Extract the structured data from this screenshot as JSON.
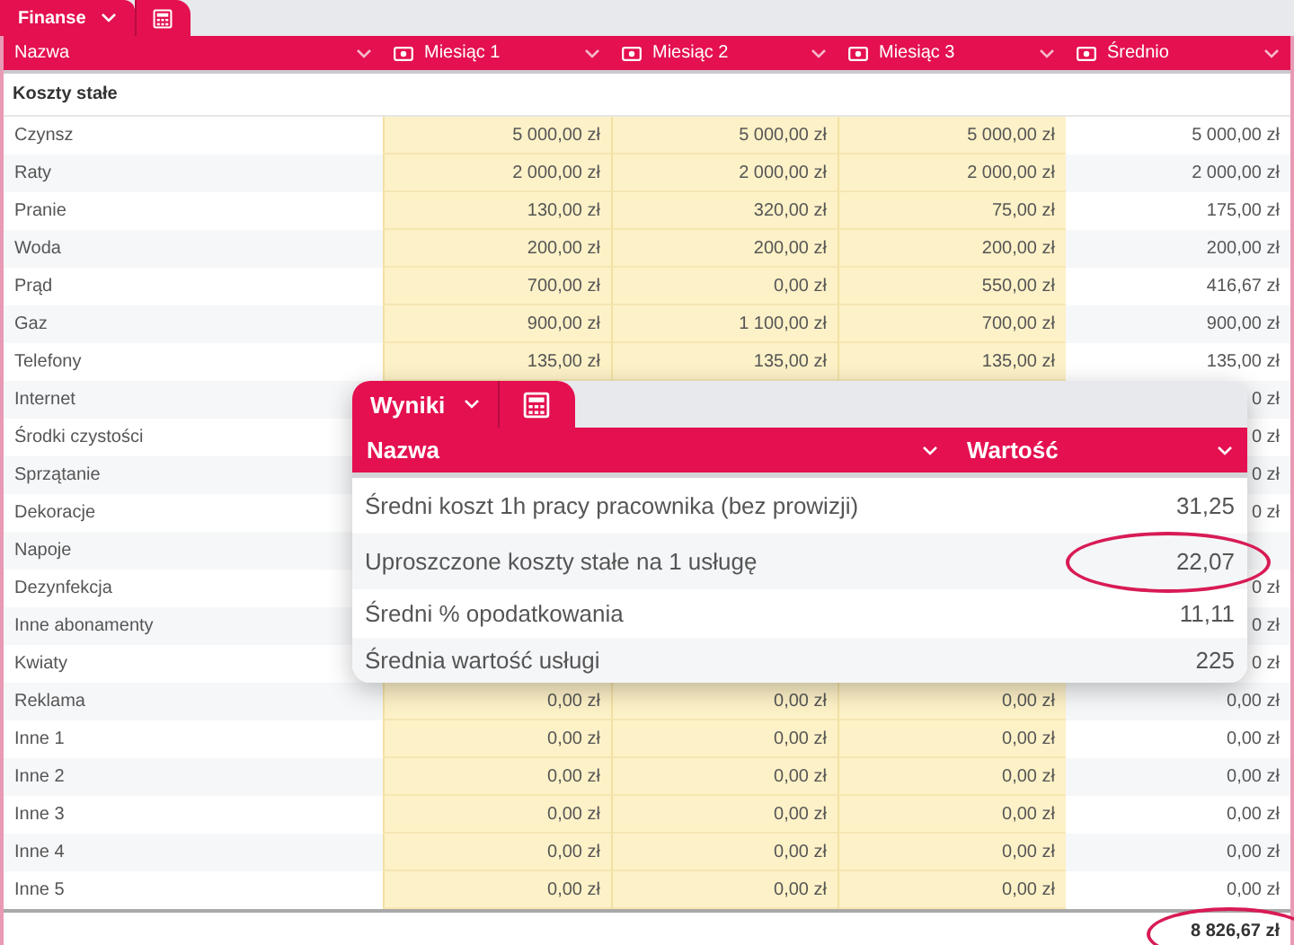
{
  "sheet_tab": {
    "label": "Finanse"
  },
  "table": {
    "columns": [
      {
        "label": "Nazwa",
        "kind": "text"
      },
      {
        "label": "Miesiąc 1",
        "kind": "money"
      },
      {
        "label": "Miesiąc 2",
        "kind": "money"
      },
      {
        "label": "Miesiąc 3",
        "kind": "money"
      },
      {
        "label": "Średnio",
        "kind": "money"
      }
    ],
    "section": "Koszty stałe",
    "rows": [
      {
        "name": "Czynsz",
        "cells": [
          "5 000,00 zł",
          "5 000,00 zł",
          "5 000,00 zł",
          "5 000,00 zł"
        ]
      },
      {
        "name": "Raty",
        "cells": [
          "2 000,00 zł",
          "2 000,00 zł",
          "2 000,00 zł",
          "2 000,00 zł"
        ]
      },
      {
        "name": "Pranie",
        "cells": [
          "130,00 zł",
          "320,00 zł",
          "75,00 zł",
          "175,00 zł"
        ]
      },
      {
        "name": "Woda",
        "cells": [
          "200,00 zł",
          "200,00 zł",
          "200,00 zł",
          "200,00 zł"
        ]
      },
      {
        "name": "Prąd",
        "cells": [
          "700,00 zł",
          "0,00 zł",
          "550,00 zł",
          "416,67 zł"
        ]
      },
      {
        "name": "Gaz",
        "cells": [
          "900,00 zł",
          "1 100,00 zł",
          "700,00 zł",
          "900,00 zł"
        ]
      },
      {
        "name": "Telefony",
        "cells": [
          "135,00 zł",
          "135,00 zł",
          "135,00 zł",
          "135,00 zł"
        ]
      },
      {
        "name": "Internet",
        "cells": [
          null,
          null,
          null,
          "0 zł"
        ]
      },
      {
        "name": "Środki czystości",
        "cells": [
          null,
          null,
          null,
          "0 zł"
        ]
      },
      {
        "name": "Sprzątanie",
        "cells": [
          null,
          null,
          null,
          "0 zł"
        ]
      },
      {
        "name": "Dekoracje",
        "cells": [
          null,
          null,
          null,
          "0 zł"
        ]
      },
      {
        "name": "Napoje",
        "cells": [
          null,
          null,
          null,
          null
        ]
      },
      {
        "name": "Dezynfekcja",
        "cells": [
          null,
          null,
          null,
          "0 zł"
        ]
      },
      {
        "name": "Inne abonamenty",
        "cells": [
          null,
          null,
          null,
          "0 zł"
        ]
      },
      {
        "name": "Kwiaty",
        "cells": [
          null,
          null,
          null,
          "0 zł"
        ]
      },
      {
        "name": "Reklama",
        "cells": [
          "0,00 zł",
          "0,00 zł",
          "0,00 zł",
          "0,00 zł"
        ]
      },
      {
        "name": "Inne 1",
        "cells": [
          "0,00 zł",
          "0,00 zł",
          "0,00 zł",
          "0,00 zł"
        ]
      },
      {
        "name": "Inne 2",
        "cells": [
          "0,00 zł",
          "0,00 zł",
          "0,00 zł",
          "0,00 zł"
        ]
      },
      {
        "name": "Inne 3",
        "cells": [
          "0,00 zł",
          "0,00 zł",
          "0,00 zł",
          "0,00 zł"
        ]
      },
      {
        "name": "Inne 4",
        "cells": [
          "0,00 zł",
          "0,00 zł",
          "0,00 zł",
          "0,00 zł"
        ]
      },
      {
        "name": "Inne 5",
        "cells": [
          "0,00 zł",
          "0,00 zł",
          "0,00 zł",
          "0,00 zł"
        ]
      }
    ],
    "total": {
      "value": "8 826,67 zł",
      "highlighted": true
    }
  },
  "results_panel": {
    "tab": "Wyniki",
    "columns": [
      "Nazwa",
      "Wartość"
    ],
    "rows": [
      {
        "label": "Średni koszt 1h pracy pracownika (bez prowizji)",
        "value": "31,25",
        "highlighted": false
      },
      {
        "label": "Uproszczone koszty stałe na 1 usługę",
        "value": "22,07",
        "highlighted": true
      },
      {
        "label": "Średni % opodatkowania",
        "value": "11,11",
        "highlighted": false
      },
      {
        "label": "Średnia wartość usługi",
        "value": "225",
        "highlighted": false
      }
    ]
  }
}
